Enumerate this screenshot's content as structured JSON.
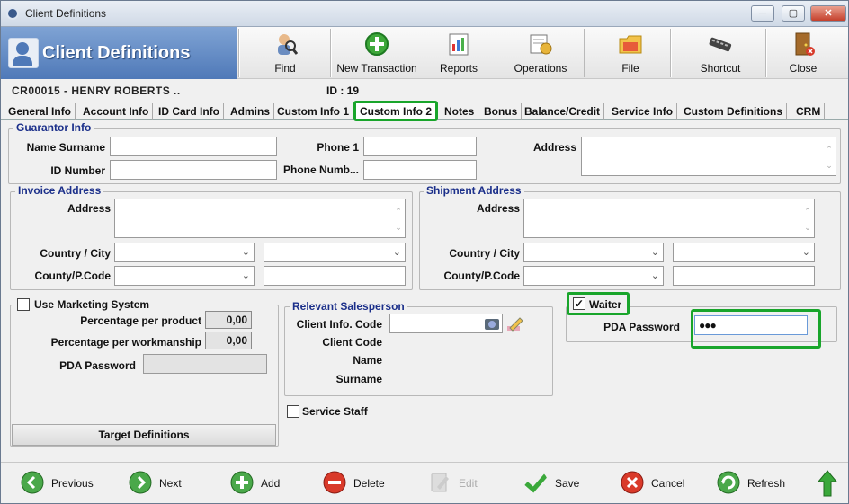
{
  "window": {
    "title": "Client Definitions",
    "controls": [
      "─",
      "▢",
      "✕"
    ]
  },
  "brand": {
    "title": "Client Definitions"
  },
  "toolbar": {
    "find": "Find",
    "new_transaction": "New Transaction",
    "reports": "Reports",
    "operations": "Operations",
    "file": "File",
    "shortcut": "Shortcut",
    "close": "Close"
  },
  "client": {
    "code_line": "CR00015  -     HENRY    ROBERTS  ..",
    "id_text": "ID : 19"
  },
  "tabs": [
    "General Info",
    "Account Info",
    "ID Card Info",
    "Admins",
    "Custom Info 1",
    "Custom Info 2",
    "Notes",
    "Bonus",
    "Balance/Credit",
    "Service Info",
    "Custom Definitions",
    "CRM"
  ],
  "guarantor": {
    "title": "Guarantor Info",
    "name_surname_label": "Name Surname",
    "id_number_label": "ID Number",
    "phone1_label": "Phone 1",
    "phone_number_label": "Phone Numb...",
    "address_label": "Address",
    "name_surname": "",
    "id_number": "",
    "phone1": "",
    "phone_number": ""
  },
  "invoice": {
    "title": "Invoice Address",
    "address_label": "Address",
    "country_city_label": "Country / City",
    "county_pcode_label": "County/P.Code"
  },
  "shipment": {
    "title": "Shipment Address",
    "address_label": "Address",
    "country_city_label": "Country / City",
    "county_pcode_label": "County/P.Code"
  },
  "marketing": {
    "use_label": "Use Marketing System",
    "pct_product_label": "Percentage per product",
    "pct_product": "0,00",
    "pct_workmanship_label": "Percentage per workmanship",
    "pct_workmanship": "0,00",
    "pda_password_label": "PDA Password",
    "target_button": "Target Definitions"
  },
  "salesperson": {
    "title": "Relevant Salesperson",
    "client_info_code_label": "Client Info. Code",
    "client_code_label": "Client Code",
    "name_label": "Name",
    "surname_label": "Surname"
  },
  "service_staff": {
    "label": "Service Staff"
  },
  "waiter": {
    "label": "Waiter",
    "checked": true,
    "pda_password_label": "PDA Password",
    "pda_password": "●●●"
  },
  "footer": {
    "previous": "Previous",
    "next": "Next",
    "add": "Add",
    "delete": "Delete",
    "edit": "Edit",
    "save": "Save",
    "cancel": "Cancel",
    "refresh": "Refresh"
  },
  "colors": {
    "highlight": "#19a52b",
    "brand": "#4f79b8",
    "group_title": "#1b2f8a"
  }
}
